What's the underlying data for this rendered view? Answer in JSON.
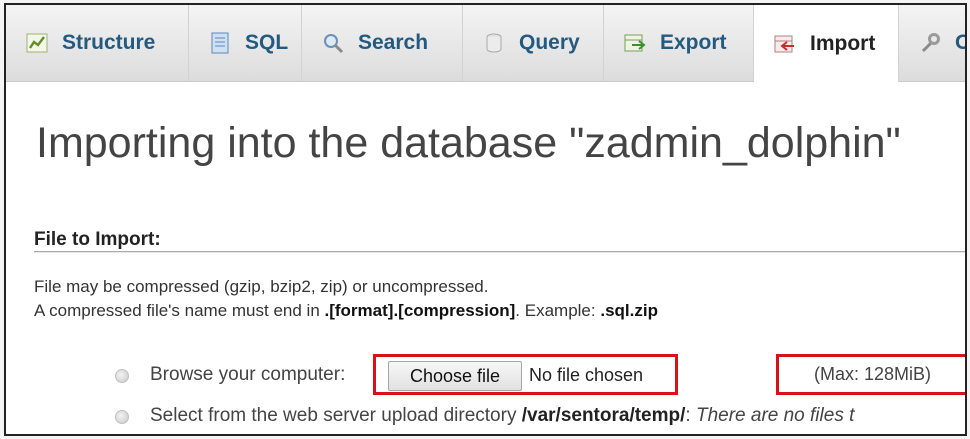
{
  "tabs": [
    {
      "label": "Structure",
      "icon": "structure-icon",
      "active": false
    },
    {
      "label": "SQL",
      "icon": "sql-icon",
      "active": false
    },
    {
      "label": "Search",
      "icon": "search-icon",
      "active": false
    },
    {
      "label": "Query",
      "icon": "query-icon",
      "active": false
    },
    {
      "label": "Export",
      "icon": "export-icon",
      "active": false
    },
    {
      "label": "Import",
      "icon": "import-icon",
      "active": true
    },
    {
      "label": "O",
      "icon": "operations-wrench-icon",
      "active": false
    }
  ],
  "page": {
    "title": "Importing into the database \"zadmin_dolphin\"",
    "section_title": "File to Import:"
  },
  "description": {
    "line1": "File may be compressed (gzip, bzip2, zip) or uncompressed.",
    "line2_prefix": "A compressed file's name must end in ",
    "line2_bold": ".[format].[compression]",
    "line2_mid": ". Example: ",
    "line2_example": ".sql.zip"
  },
  "upload": {
    "browse_label": "Browse your computer:",
    "choose_button": "Choose file",
    "no_file_text": "No file chosen",
    "max_size": "(Max: 128MiB)",
    "server_label": "Select from the web server upload directory ",
    "server_path": "/var/sentora/temp/",
    "server_colon": ":",
    "server_note": " There are no files t"
  },
  "colors": {
    "highlight": "#d8121b",
    "tab_link": "#235a81",
    "tab_bar": "#e4e4e4"
  }
}
